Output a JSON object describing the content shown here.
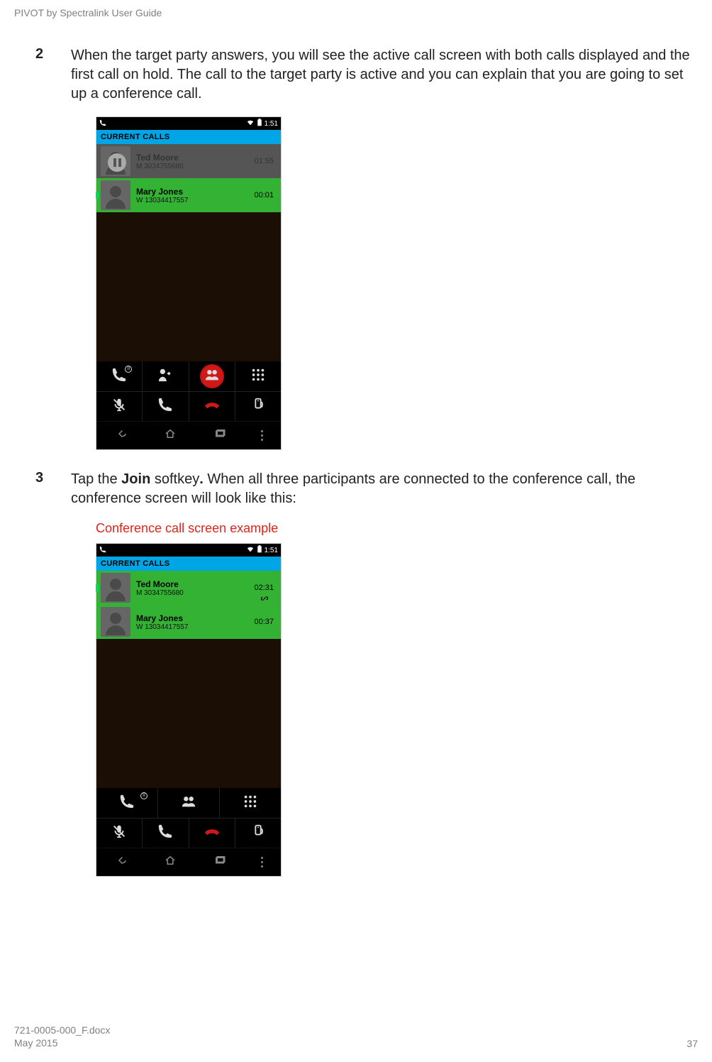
{
  "running_header": "PIVOT by Spectralink User Guide",
  "steps": {
    "s2": {
      "num": "2",
      "text": "When the target party answers, you will see the active call screen with both calls displayed and the first call on hold. The call to the target party is active and you can explain that you are going to set up a conference call."
    },
    "s3": {
      "num": "3",
      "text_before": "Tap the ",
      "bold": "Join",
      "text_mid": " softkey",
      "period": ".",
      "text_after": " When all three participants are connected to the conference call, the conference screen will look like this:"
    }
  },
  "caption": "Conference call screen example",
  "phone": {
    "time": "1:51",
    "banner": "CURRENT CALLS",
    "held": {
      "name": "Ted Moore",
      "number": "M 3034755680",
      "timer": "01:55"
    },
    "active": {
      "name": "Mary Jones",
      "number": "W 13034417557",
      "timer": "00:01"
    },
    "conf1": {
      "name": "Ted Moore",
      "number": "M 3034755680",
      "timer": "02:31"
    },
    "conf2": {
      "name": "Mary Jones",
      "number": "W 13034417557",
      "timer": "00:37"
    }
  },
  "footer": {
    "doc": "721-0005-000_F.docx",
    "date": "May 2015",
    "page": "37"
  }
}
